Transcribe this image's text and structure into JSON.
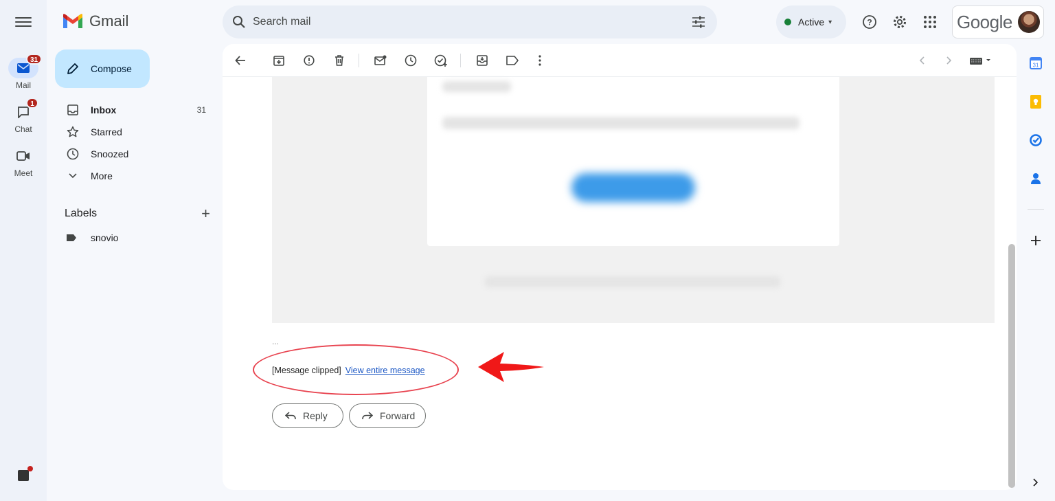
{
  "app": {
    "name": "Gmail"
  },
  "rail": {
    "items": [
      {
        "label": "Mail",
        "badge": "31"
      },
      {
        "label": "Chat",
        "badge": "1"
      },
      {
        "label": "Meet",
        "badge": ""
      }
    ]
  },
  "compose": {
    "label": "Compose"
  },
  "nav": {
    "items": [
      {
        "label": "Inbox",
        "count": "31"
      },
      {
        "label": "Starred",
        "count": ""
      },
      {
        "label": "Snoozed",
        "count": ""
      },
      {
        "label": "More",
        "count": ""
      }
    ]
  },
  "labels": {
    "title": "Labels",
    "add": "+",
    "items": [
      {
        "label": "snovio"
      }
    ]
  },
  "search": {
    "placeholder": "Search mail"
  },
  "status": {
    "label": "Active",
    "color": "#188038"
  },
  "account": {
    "brand": "Google"
  },
  "message": {
    "ellipsis": "...",
    "clipped_text": "[Message clipped]",
    "view_entire": "View entire message"
  },
  "actions": {
    "reply": "Reply",
    "forward": "Forward"
  },
  "colors": {
    "accent": "#c2e7ff",
    "annotation": "#e8434f",
    "link": "#1a56c4"
  }
}
